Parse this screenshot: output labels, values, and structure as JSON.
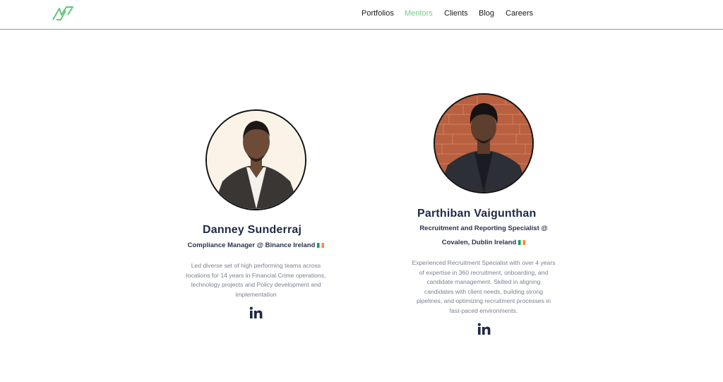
{
  "nav": {
    "items": [
      {
        "label": "Portfolios"
      },
      {
        "label": "Mentors"
      },
      {
        "label": "Clients"
      },
      {
        "label": "Blog"
      },
      {
        "label": "Careers"
      }
    ],
    "active": "Mentors",
    "accent_color": "#6fcf86"
  },
  "logo": {
    "icon": "brand-logo-icon"
  },
  "mentors": [
    {
      "name": "Danney Sunderraj",
      "role_line1": "Compliance Manager @ Binance Ireland",
      "flag": "ireland-flag-icon",
      "bio_lines": [
        "Led diverse set of high performing teams across",
        "locations for 14 years in Financial Crime operations,",
        "technology projects and Policy development and",
        "implementation"
      ],
      "social_icon": "linkedin-icon"
    },
    {
      "name": "Parthiban Vaigunthan",
      "role_line1": "Recruitment and Reporting Specialist @",
      "role_line2": "Covalen, Dublin Ireland",
      "flag": "ireland-flag-icon",
      "bio_lines": [
        "Experienced Recruitment Specialist with over 4 years",
        "of expertise in 360 recruitment, onboarding, and",
        "candidate management. Skilled in aligning",
        "candidates with client needs, building strong",
        "pipelines, and optimizing recruitment processes in",
        "fast-paced environments."
      ],
      "social_icon": "linkedin-icon"
    }
  ]
}
